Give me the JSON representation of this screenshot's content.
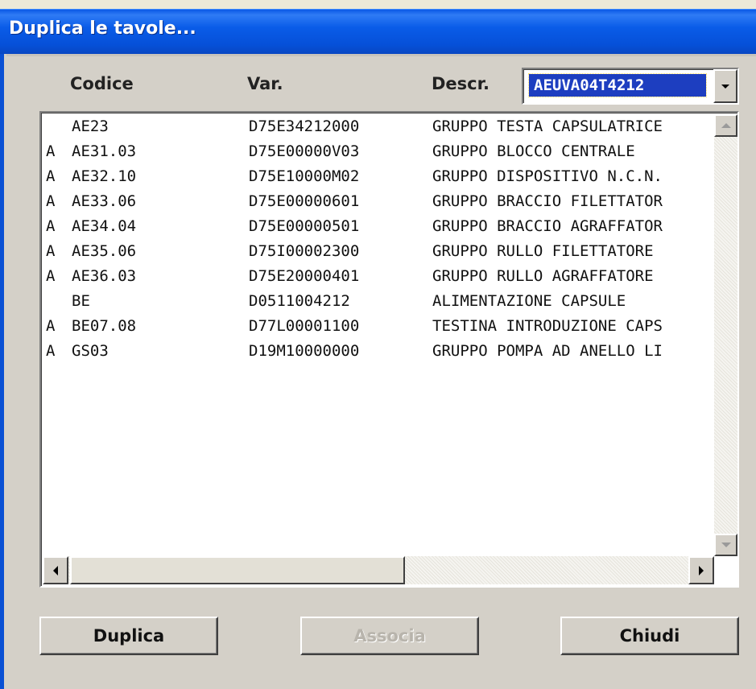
{
  "window": {
    "title": "Duplica le tavole..."
  },
  "columns": {
    "codice": "Codice",
    "var": "Var.",
    "descr": "Descr."
  },
  "combo": {
    "selected": "AEUVA04T4212"
  },
  "rows": [
    {
      "flag": "",
      "code": "AE23",
      "var": "D75E34212000",
      "desc": "GRUPPO TESTA CAPSULATRICE"
    },
    {
      "flag": "A",
      "code": "AE31.03",
      "var": "D75E00000V03",
      "desc": "GRUPPO BLOCCO CENTRALE"
    },
    {
      "flag": "A",
      "code": "AE32.10",
      "var": "D75E10000M02",
      "desc": "GRUPPO DISPOSITIVO N.C.N."
    },
    {
      "flag": "A",
      "code": "AE33.06",
      "var": "D75E00000601",
      "desc": "GRUPPO BRACCIO FILETTATOR"
    },
    {
      "flag": "A",
      "code": "AE34.04",
      "var": "D75E00000501",
      "desc": "GRUPPO BRACCIO AGRAFFATOR"
    },
    {
      "flag": "A",
      "code": "AE35.06",
      "var": "D75I00002300",
      "desc": "GRUPPO RULLO FILETTATORE"
    },
    {
      "flag": "A",
      "code": "AE36.03",
      "var": "D75E20000401",
      "desc": "GRUPPO RULLO AGRAFFATORE"
    },
    {
      "flag": "",
      "code": "BE",
      "var": "D0511004212",
      "desc": "ALIMENTAZIONE CAPSULE"
    },
    {
      "flag": "A",
      "code": "BE07.08",
      "var": "D77L00001100",
      "desc": "TESTINA INTRODUZIONE CAPS"
    },
    {
      "flag": "A",
      "code": "GS03",
      "var": "D19M10000000",
      "desc": "GRUPPO POMPA AD ANELLO LI"
    }
  ],
  "buttons": {
    "duplica": "Duplica",
    "associa": "Associa",
    "chiudi": "Chiudi"
  },
  "icons": {
    "combo_dropdown": "chevron-down-icon",
    "scroll_up": "scroll-up-arrow-icon",
    "scroll_down": "scroll-down-arrow-icon",
    "scroll_left": "scroll-left-arrow-icon",
    "scroll_right": "scroll-right-arrow-icon"
  },
  "colors": {
    "titlebar": "#0a5ce8",
    "selection": "#1d3ec0",
    "face": "#d4d0c8"
  }
}
